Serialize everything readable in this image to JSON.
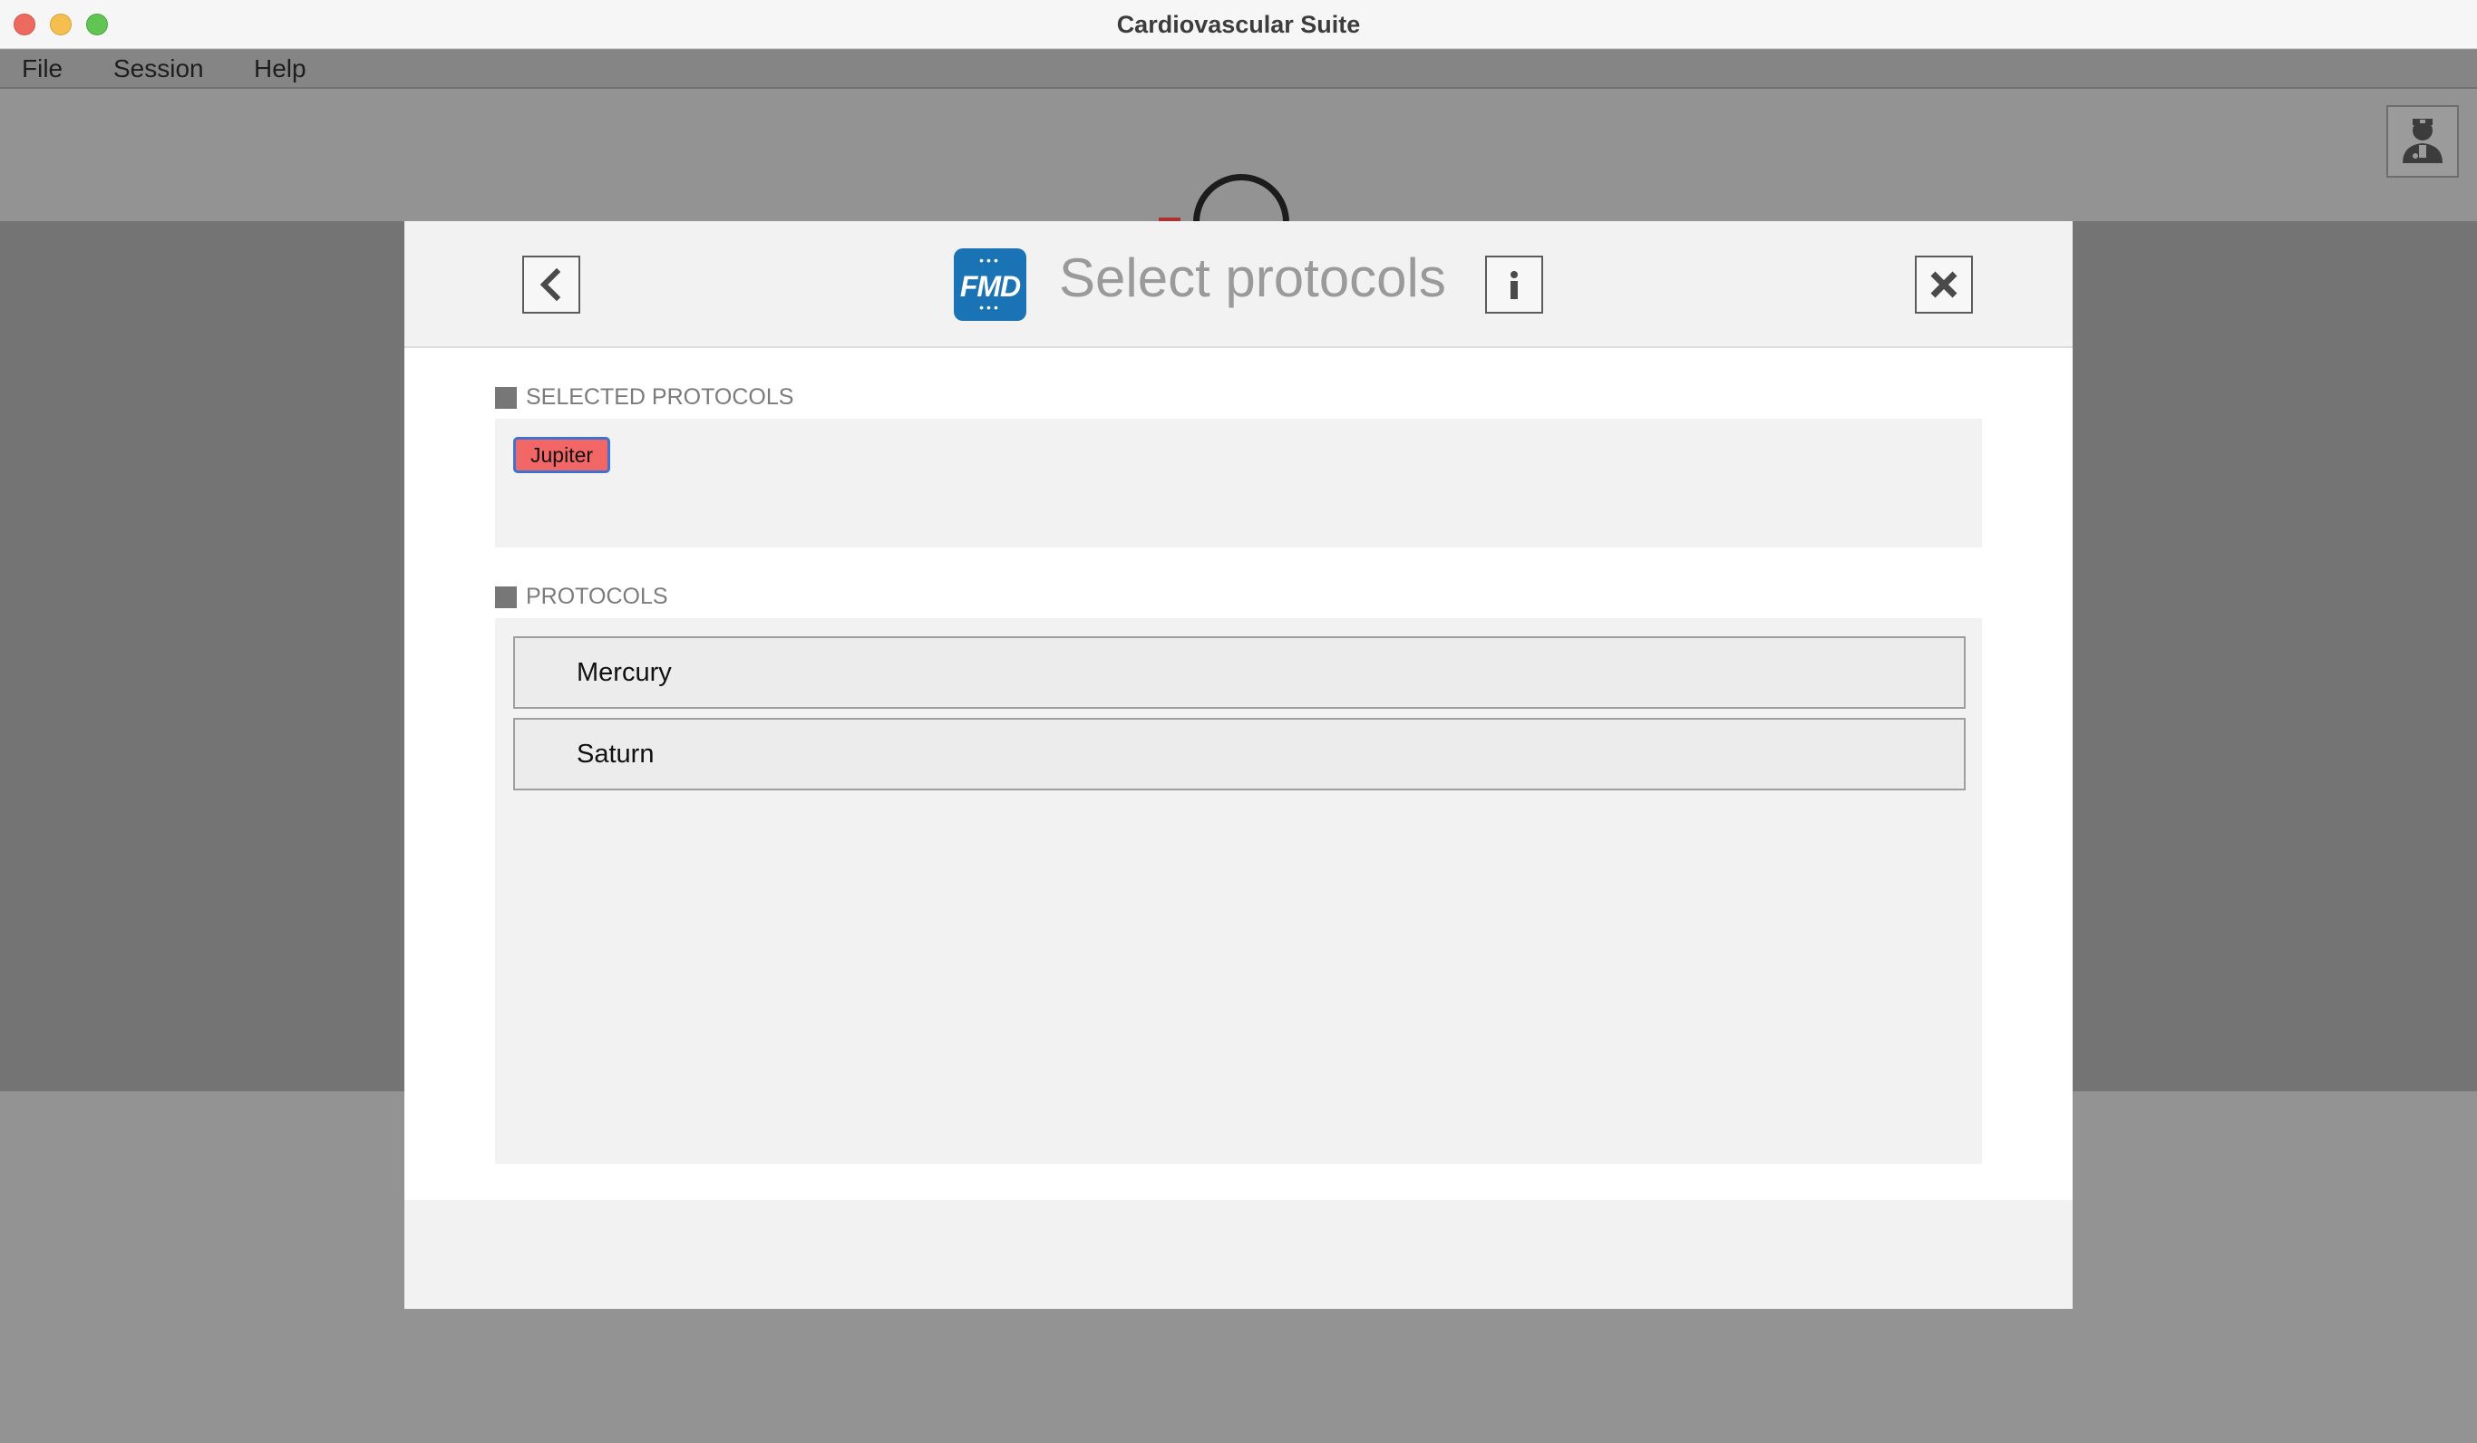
{
  "window": {
    "title": "Cardiovascular Suite"
  },
  "menu": [
    "File",
    "Session",
    "Help"
  ],
  "app_icons": {
    "user": "doctor-user-icon",
    "logo": "stethoscope-logo"
  },
  "modal": {
    "app_badge": "FMD",
    "title": "Select protocols",
    "back_icon": "chevron-left-icon",
    "info_icon": "info-icon",
    "close_icon": "close-icon",
    "selected_section": "SELECTED PROTOCOLS",
    "selected": [
      {
        "label": "Jupiter",
        "color": "#f26666"
      }
    ],
    "protocols_section": "PROTOCOLS",
    "protocols": [
      {
        "label": "Mercury"
      },
      {
        "label": "Saturn"
      }
    ]
  },
  "colors": {
    "accent": "#1a73b5",
    "chip": "#f26666",
    "chip_border": "#3d72d1"
  }
}
